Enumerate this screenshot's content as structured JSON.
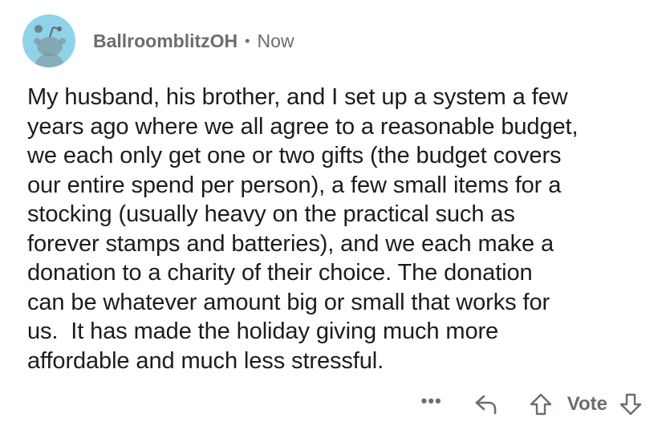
{
  "comment": {
    "username": "BallroomblitzOH",
    "separator": "•",
    "timestamp": "Now",
    "body": "My husband, his brother, and I set up a system a few\nyears ago where we all agree to a reasonable budget,\nwe each only get one or two gifts (the budget covers\nour entire spend per person), a few small items for a\nstocking (usually heavy on the practical such as\nforever stamps and batteries), and we each make a\ndonation to a charity of their choice. The donation\ncan be whatever amount big or small that works for\nus.  It has made the holiday giving much more\naffordable and much less stressful.",
    "avatar_color": "#8fd3e8"
  },
  "actions": {
    "more_label": "•••",
    "vote_label": "Vote",
    "icons": {
      "more": "more-icon",
      "reply": "reply-icon",
      "upvote": "upvote-icon",
      "downvote": "downvote-icon"
    }
  }
}
